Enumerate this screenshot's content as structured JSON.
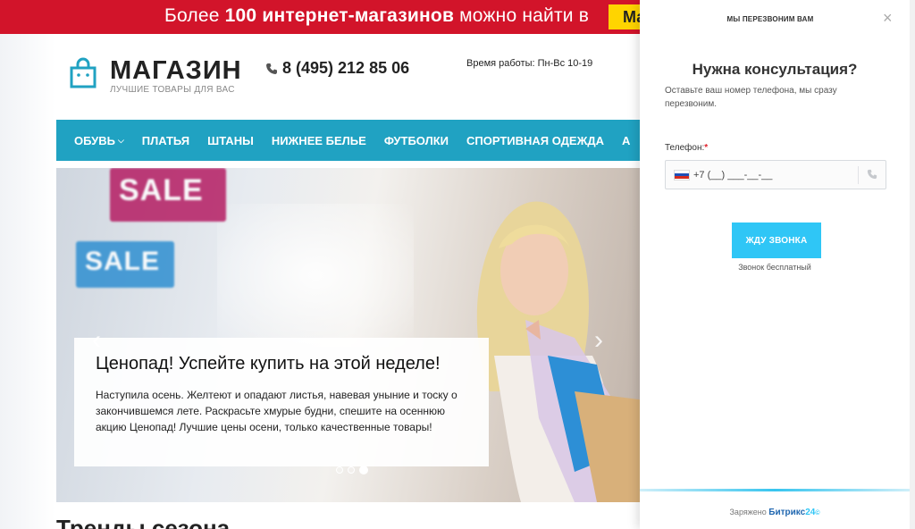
{
  "banner": {
    "text_before": "Более ",
    "text_bold": "100 интернет-магазинов",
    "text_after": " можно найти в",
    "button_label": "Ма"
  },
  "header": {
    "logo_title": "МАГАЗИН",
    "logo_subtitle": "ЛУЧШИЕ ТОВАРЫ ДЛЯ ВАС",
    "phone": "8 (495) 212 85 06",
    "hours": "Время работы: Пн-Вс 10-19"
  },
  "nav": {
    "items": [
      {
        "label": "ОБУВЬ"
      },
      {
        "label": "ПЛАТЬЯ"
      },
      {
        "label": "ШТАНЫ"
      },
      {
        "label": "НИЖНЕЕ БЕЛЬЕ"
      },
      {
        "label": "ФУТБОЛКИ"
      },
      {
        "label": "СПОРТИВНАЯ ОДЕЖДА"
      },
      {
        "label": "А"
      }
    ]
  },
  "hero": {
    "sign1": "SALE",
    "sign2": "SALE",
    "title": "Ценопад! Успейте купить на этой неделе!",
    "text": "Наступила осень. Желтеют и опадают листья, навевая уныние и тоску о закончившемся лете. Раскрасьте хмурые будни, спешите на осеннюю акцию Ценопад! Лучшие цены осени, только качественные товары!",
    "prev_arrow": "‹",
    "next_arrow": "›",
    "slides_total": 3,
    "active_slide": 3
  },
  "section": {
    "title": "Тренды сезона"
  },
  "callback": {
    "header_title": "МЫ ПЕРЕЗВОНИМ ВАМ",
    "close": "×",
    "title": "Нужна консультация?",
    "description": "Оставьте ваш номер телефона, мы сразу перезвоним.",
    "phone_label": "Телефон:",
    "required_mark": "*",
    "phone_value": "+7 (__) ___-__-__",
    "submit_label": "ЖДУ ЗВОНКА",
    "free_note": "Звонок бесплатный",
    "powered_by": "Заряжено",
    "brand_main": "Битрикс",
    "brand_num": "24",
    "brand_mark": "©"
  },
  "colors": {
    "banner_red": "#d2142a",
    "banner_yellow": "#ffd400",
    "nav_teal": "#20a2c2",
    "submit_blue": "#2fc6f6",
    "required_red": "#e0212b"
  }
}
